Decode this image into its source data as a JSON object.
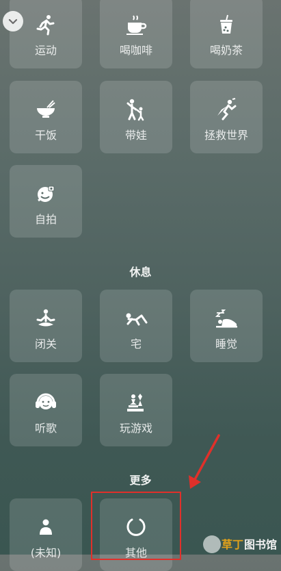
{
  "tiles_top": [
    {
      "label": "运动",
      "icon": "running-icon"
    },
    {
      "label": "喝咖啡",
      "icon": "coffee-cup-icon"
    },
    {
      "label": "喝奶茶",
      "icon": "bubble-tea-icon"
    },
    {
      "label": "干饭",
      "icon": "rice-bowl-icon"
    },
    {
      "label": "带娃",
      "icon": "parent-child-icon"
    },
    {
      "label": "拯救世界",
      "icon": "superhero-icon"
    },
    {
      "label": "自拍",
      "icon": "selfie-icon"
    }
  ],
  "section_rest": {
    "title": "休息",
    "tiles": [
      {
        "label": "闭关",
        "icon": "meditation-icon"
      },
      {
        "label": "宅",
        "icon": "lying-down-icon"
      },
      {
        "label": "睡觉",
        "icon": "sleep-zzz-icon"
      },
      {
        "label": "听歌",
        "icon": "headphones-icon"
      },
      {
        "label": "玩游戏",
        "icon": "game-pieces-icon"
      }
    ]
  },
  "section_more": {
    "title": "更多",
    "tiles": [
      {
        "label": "(未知)",
        "icon": "unknown-person-icon"
      },
      {
        "label": "其他",
        "icon": "circle-loop-icon"
      }
    ]
  },
  "watermark": {
    "part1": "草丁",
    "part2": "图书馆"
  },
  "colors": {
    "highlight": "#e0302a",
    "arrow": "#e0302a",
    "watermark_accent": "#e3a21a"
  }
}
